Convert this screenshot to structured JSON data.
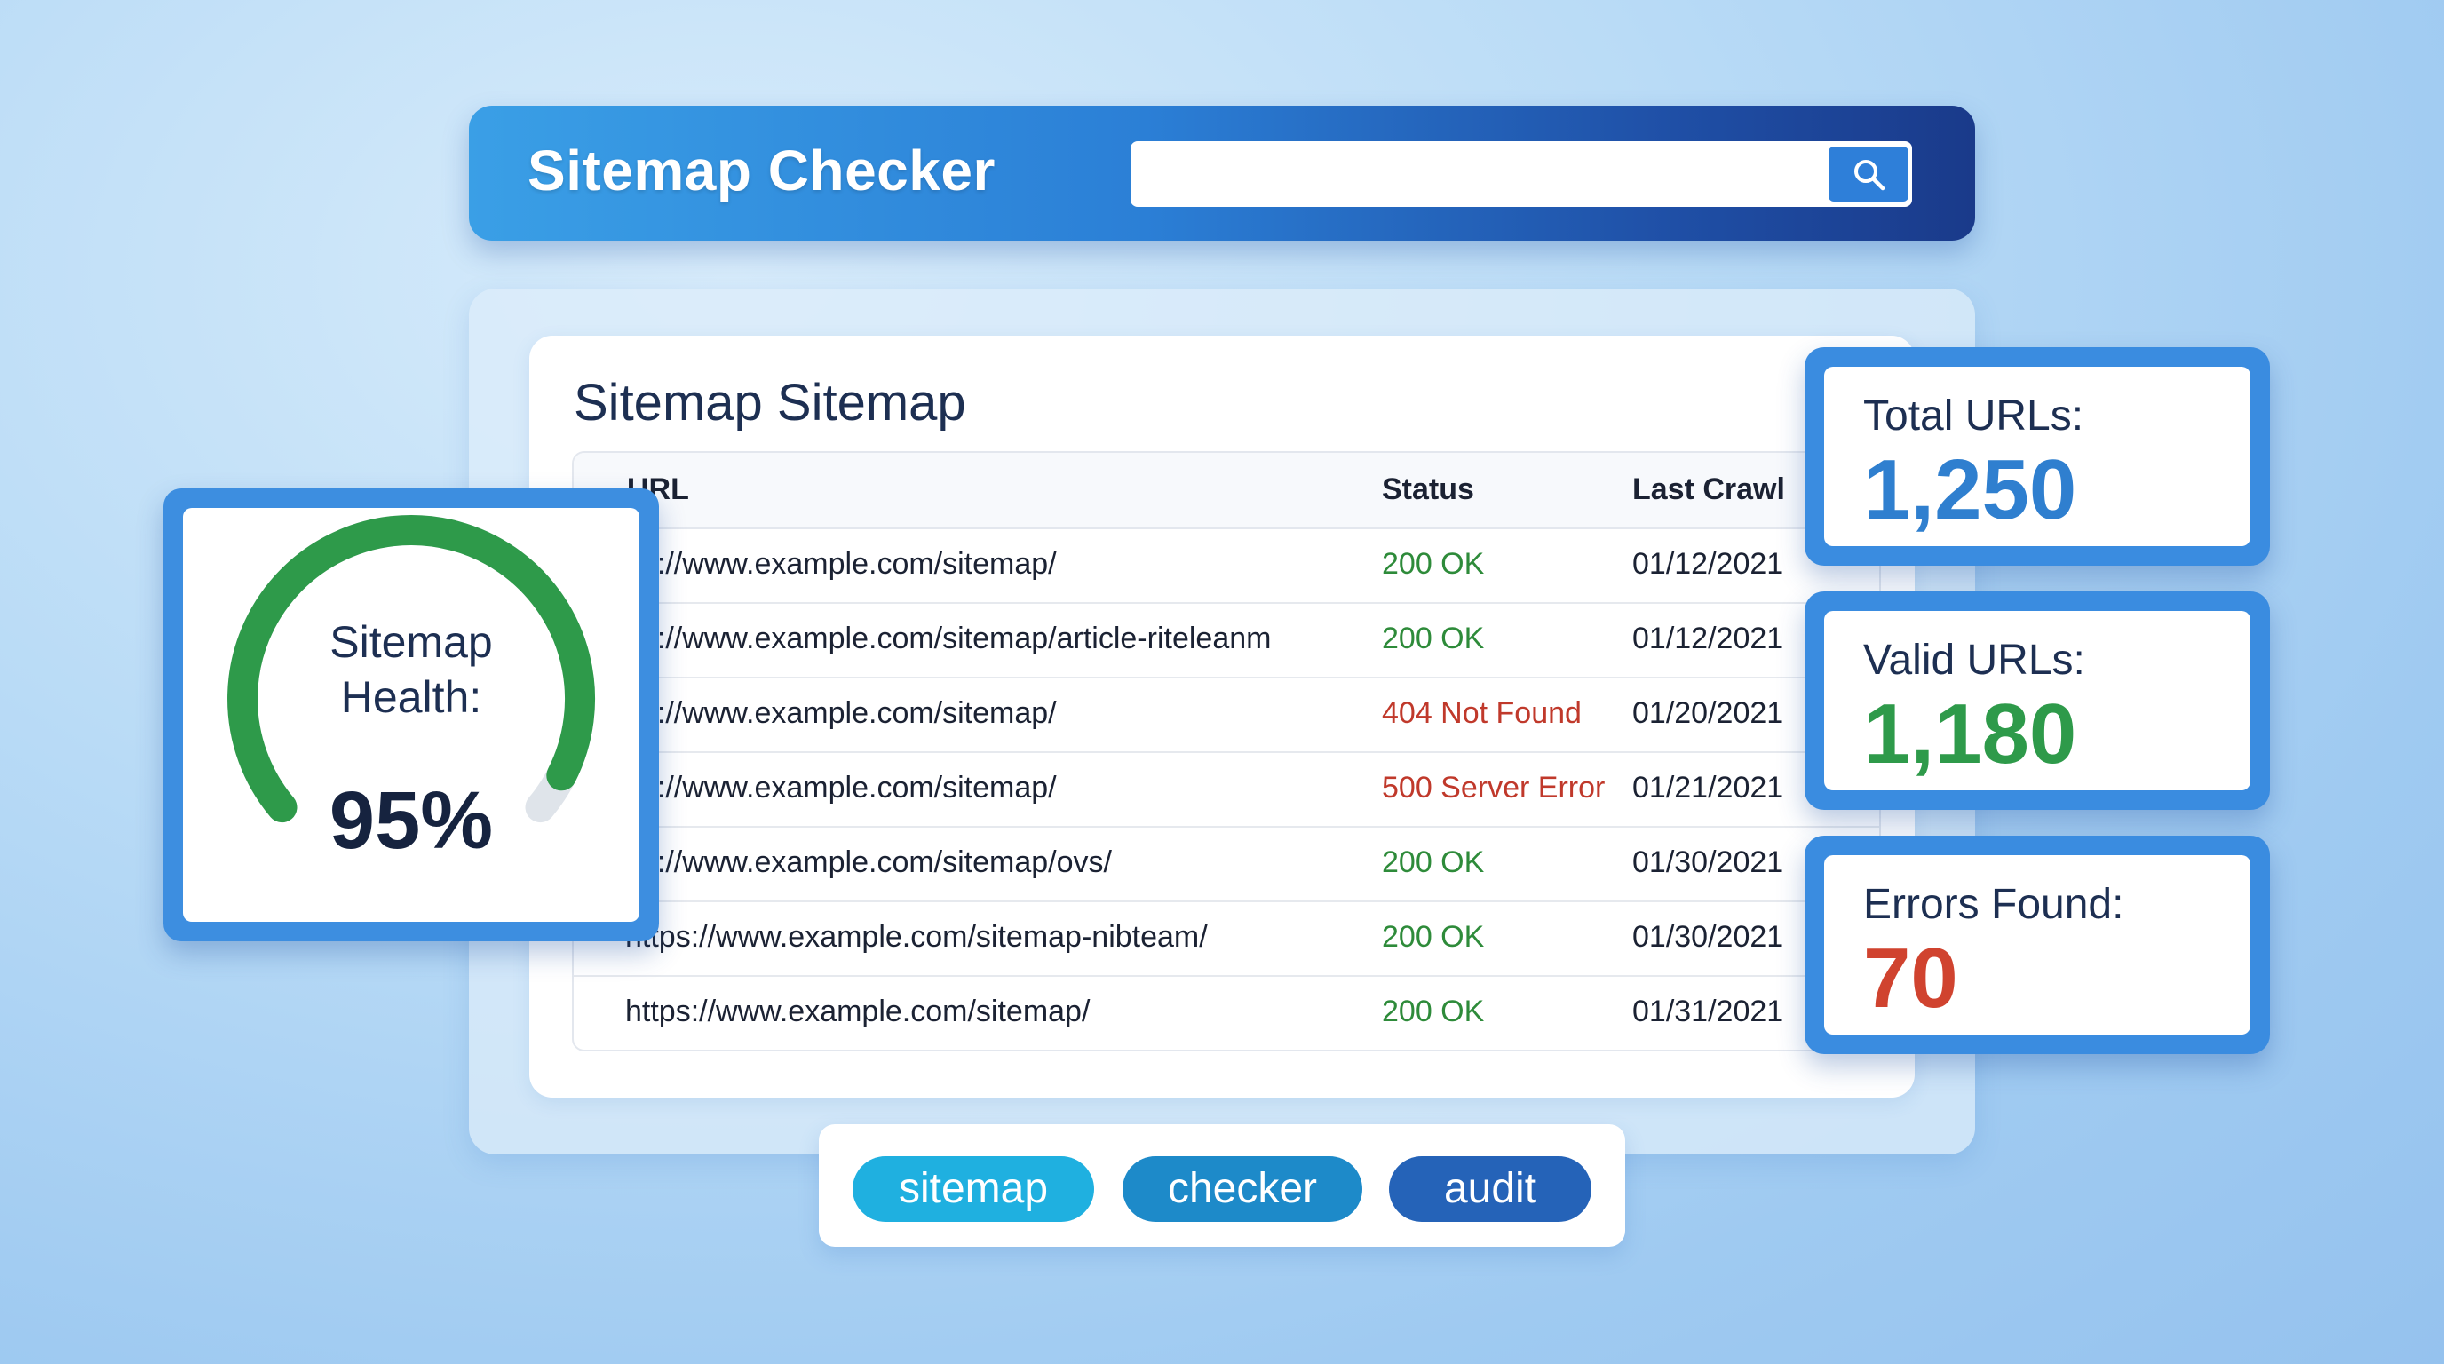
{
  "header": {
    "title": "Sitemap Checker",
    "search": {
      "value": "",
      "placeholder": ""
    }
  },
  "card": {
    "title": "Sitemap Sitemap",
    "columns": [
      "URL",
      "Status",
      "Last Crawl"
    ],
    "rows": [
      {
        "url": "ps://www.example.com/sitemap/",
        "status": "200 OK",
        "status_type": "ok",
        "date": "01/12/2021"
      },
      {
        "url": "ps://www.example.com/sitemap/article-riteleanm",
        "status": "200 OK",
        "status_type": "ok",
        "date": "01/12/2021"
      },
      {
        "url": "ps://www.example.com/sitemap/",
        "status": "404 Not Found",
        "status_type": "error",
        "date": "01/20/2021"
      },
      {
        "url": "ps://www.example.com/sitemap/",
        "status": "500 Server Error",
        "status_type": "error",
        "date": "01/21/2021"
      },
      {
        "url": "ps://www.example.com/sitemap/ovs/",
        "status": "200 OK",
        "status_type": "ok",
        "date": "01/30/2021"
      },
      {
        "url": "https://www.example.com/sitemap-nibteam/",
        "status": "200 OK",
        "status_type": "ok",
        "date": "01/30/2021"
      },
      {
        "url": "https://www.example.com/sitemap/",
        "status": "200 OK",
        "status_type": "ok",
        "date": "01/31/2021"
      }
    ]
  },
  "gauge": {
    "label_line1": "Sitemap",
    "label_line2": "Health:",
    "value_text": "95%",
    "value": 0.95,
    "color": "#2e9a4a",
    "track_color": "#dfe4ea"
  },
  "stats": [
    {
      "label": "Total URLs:",
      "value": "1,250",
      "color": "#2f7fcf"
    },
    {
      "label": "Valid URLs:",
      "value": "1,180",
      "color": "#2e9a4a"
    },
    {
      "label": "Errors Found:",
      "value": "70",
      "color": "#d0432f"
    }
  ],
  "tags": [
    {
      "label": "sitemap",
      "color": "#1fb0e0"
    },
    {
      "label": "checker",
      "color": "#1d8ac9"
    },
    {
      "label": "audit",
      "color": "#2563b8"
    }
  ],
  "icons": {
    "search": "search-icon"
  },
  "colors": {
    "status_ok": "#2e8b3a",
    "status_error": "#c0392b",
    "header_start": "#3a9fe6",
    "header_end": "#1a3a8a"
  }
}
